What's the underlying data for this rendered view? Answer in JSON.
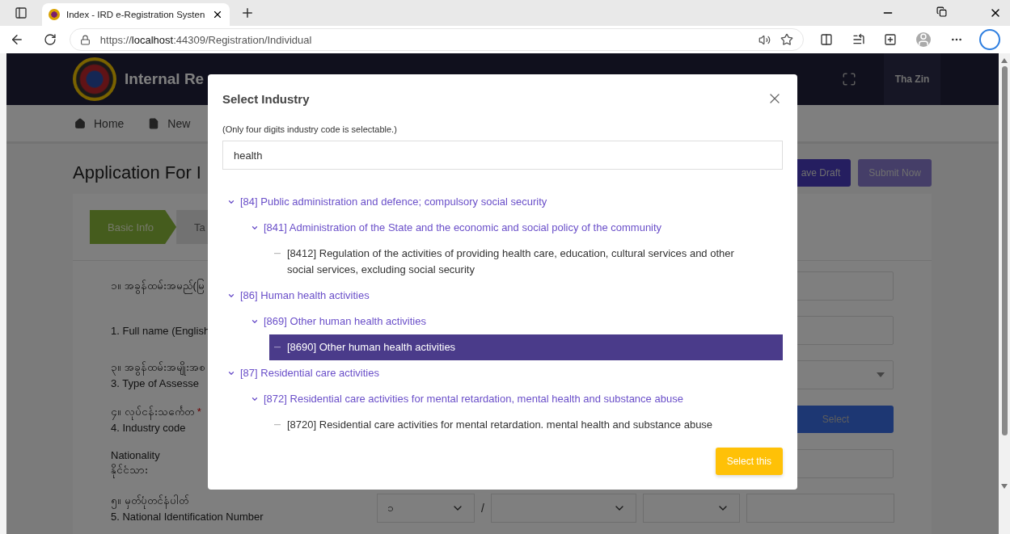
{
  "browser": {
    "tab_title": "Index - IRD e-Registration Systen",
    "url": "https://**localhost**:44309/Registration/Individual"
  },
  "header": {
    "title": "Internal Re",
    "user": "Tha Zin"
  },
  "nav": [
    {
      "label": "Home"
    },
    {
      "label": "New"
    }
  ],
  "heading": "Application For I",
  "actions": [
    {
      "label": "ave Draft",
      "kind": "primary"
    },
    {
      "label": "Submit Now",
      "kind": "secondary"
    }
  ],
  "steps": [
    {
      "label": "Basic Info",
      "selected": true
    },
    {
      "label": "Ta",
      "selected": false
    }
  ],
  "form": [
    {
      "kind": "input",
      "lines": [
        "၁။ အခွန်ထမ်းအမည်(မြ"
      ]
    },
    {
      "kind": "input",
      "lines": [
        "1. Full name (English"
      ]
    },
    {
      "kind": "select",
      "lines": [
        "၃။ အခွန်ထမ်းအမျိုးအစ",
        "3. Type of Assesse"
      ]
    },
    {
      "kind": "button",
      "lines": [
        "၄။ လုပ်ငန်းသင်္ကေတ",
        "4. Industry code"
      ],
      "required_mark": "*",
      "button": "Select"
    },
    {
      "kind": "input",
      "lines": [
        "Nationality",
        "နိုင်ငံသား"
      ]
    },
    {
      "kind": "nid",
      "lines": [
        "၅။ မှတ်ပုံတင်နံပါတ်",
        "5. National Identification Number"
      ],
      "state": "၁",
      "separator": "/"
    }
  ],
  "modal": {
    "title": "Select Industry",
    "hint": "(Only four digits industry code is selectable.)",
    "search": "health",
    "button": "Select this",
    "tree": [
      {
        "label": "[84] Public administration and defence; compulsory social security",
        "expanded": true,
        "selected": false,
        "children": [
          {
            "label": "[841] Administration of the State and the economic and social policy of the community",
            "expanded": true,
            "selected": false,
            "children": [
              {
                "label": "[8412] Regulation of the activities of providing health care, education, cultural services and other social services, excluding social security",
                "expanded": false,
                "selected": false
              }
            ]
          }
        ]
      },
      {
        "label": "[86] Human health activities",
        "expanded": true,
        "selected": false,
        "children": [
          {
            "label": "[869] Other human health activities",
            "expanded": true,
            "selected": false,
            "children": [
              {
                "label": "[8690] Other human health activities",
                "expanded": false,
                "selected": true
              }
            ]
          }
        ]
      },
      {
        "label": "[87] Residential care activities",
        "expanded": true,
        "selected": false,
        "children": [
          {
            "label": "[872] Residential care activities for mental retardation, mental health and substance abuse",
            "expanded": true,
            "selected": false,
            "children": [
              {
                "label": "[8720] Residential care activities for mental retardation. mental health and substance abuse",
                "expanded": false,
                "selected": false
              }
            ]
          }
        ]
      }
    ]
  }
}
